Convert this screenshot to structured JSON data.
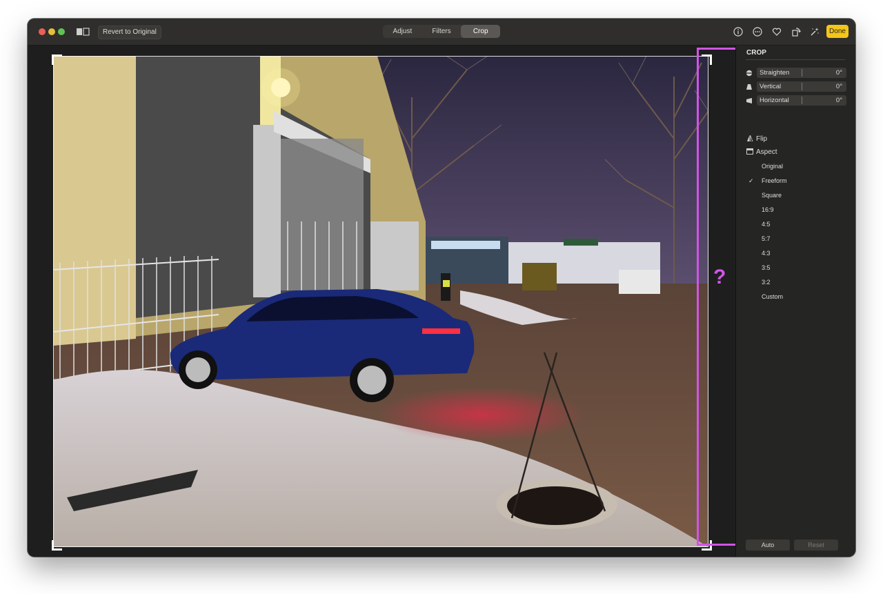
{
  "toolbar": {
    "revert_label": "Revert to Original",
    "tabs": [
      {
        "label": "Adjust",
        "active": false
      },
      {
        "label": "Filters",
        "active": false
      },
      {
        "label": "Crop",
        "active": true
      }
    ],
    "done_label": "Done",
    "icons": [
      "info-icon",
      "more-icon",
      "heart-icon",
      "rotate-icon",
      "magic-wand-icon"
    ]
  },
  "overlay": {
    "question_mark": "?"
  },
  "sidebar": {
    "section_title": "CROP",
    "sliders": [
      {
        "label": "Straighten",
        "value": "0°"
      },
      {
        "label": "Vertical",
        "value": "0°"
      },
      {
        "label": "Horizontal",
        "value": "0°"
      }
    ],
    "flip_label": "Flip",
    "aspect_label": "Aspect",
    "aspect_options": [
      "Original",
      "Freeform",
      "Square",
      "16:9",
      "4:5",
      "5:7",
      "4:3",
      "3:5",
      "3:2",
      "Custom"
    ],
    "aspect_selected": "Freeform",
    "check_mark": "✓",
    "auto_label": "Auto",
    "reset_label": "Reset"
  },
  "colors": {
    "accent_done": "#f5c518",
    "highlight": "#d155e6"
  }
}
